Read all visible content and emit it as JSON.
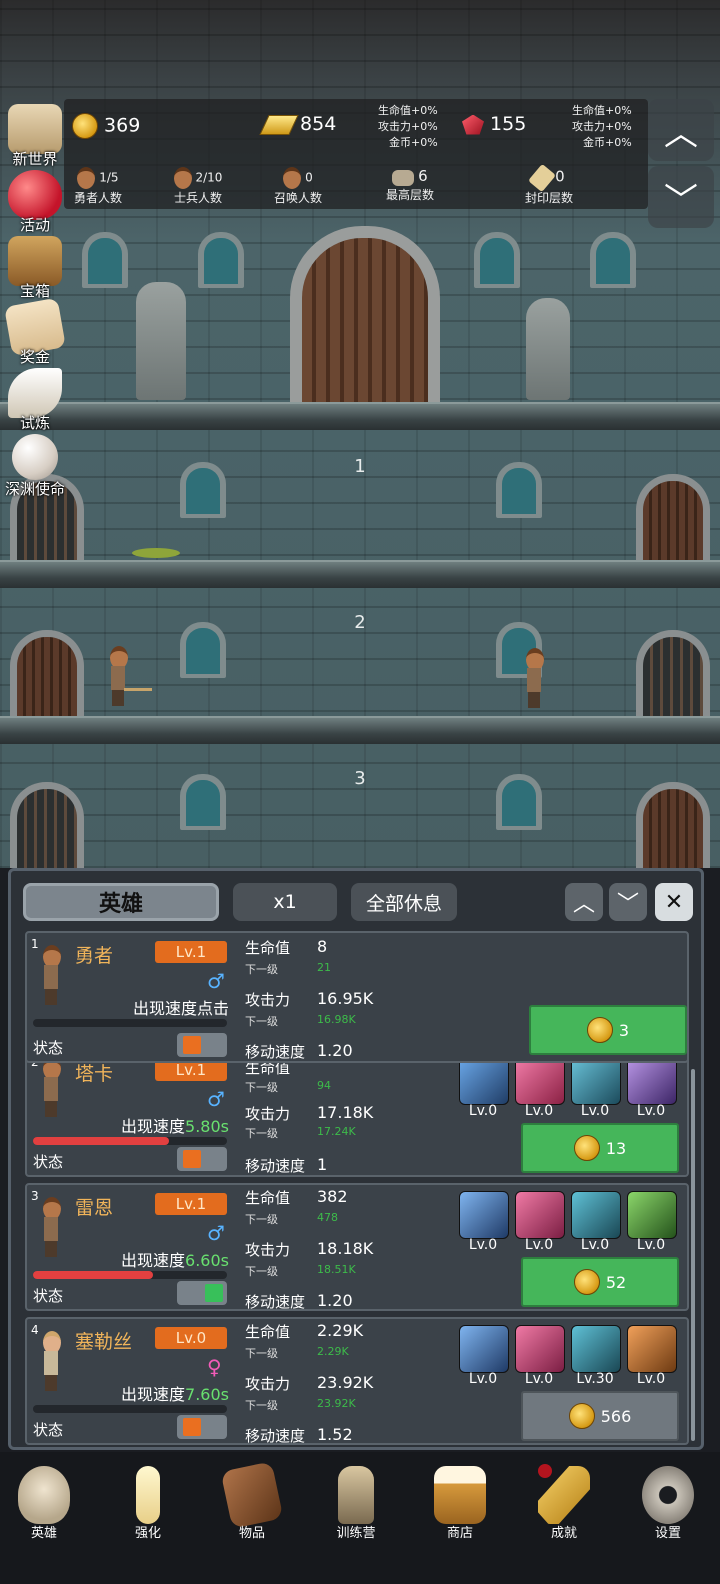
{
  "resources": {
    "coins": "369",
    "gold": "854",
    "gems": "155",
    "bonus_left": [
      "生命值+0%",
      "攻击力+0%",
      "金币+0%"
    ],
    "bonus_right": [
      "生命值+0%",
      "攻击力+0%",
      "金币+0%"
    ]
  },
  "counts": [
    {
      "value": "1/5",
      "label": "勇者人数"
    },
    {
      "value": "2/10",
      "label": "士兵人数"
    },
    {
      "value": "0",
      "label": "召唤人数"
    },
    {
      "value": "6",
      "label": "最高层数"
    },
    {
      "value": "0",
      "label": "封印层数"
    }
  ],
  "left_menu": [
    "新世界",
    "活动",
    "宝箱",
    "奖金",
    "试炼",
    "深渊使命"
  ],
  "floors": [
    "1",
    "2",
    "3"
  ],
  "panel": {
    "tab": "英雄",
    "speed": "x1",
    "rest_all": "全部休息"
  },
  "labels": {
    "hp": "生命值",
    "atk": "攻击力",
    "next": "下一级",
    "move": "移动速度",
    "state": "状态"
  },
  "heroes": [
    {
      "idx": "1",
      "name": "勇者",
      "lv": "Lv.1",
      "sex": "♂",
      "appear": "出现速度点击",
      "appear_time": "",
      "hp": "8",
      "hp_next": "21",
      "atk": "16.95K",
      "atk_next": "16.98K",
      "move": "1.20",
      "cost": "3",
      "bar": 0,
      "active": false,
      "equips": []
    },
    {
      "idx": "2",
      "name": "塔卡",
      "lv": "Lv.1",
      "sex": "♂",
      "appear": "出现速度",
      "appear_time": "5.80s",
      "hp": "",
      "hp_next": "94",
      "atk": "17.18K",
      "atk_next": "17.24K",
      "move": "1",
      "cost": "13",
      "bar": 0.7,
      "active": false,
      "equips": [
        "Lv.0",
        "Lv.0",
        "Lv.0",
        "Lv.0"
      ]
    },
    {
      "idx": "3",
      "name": "雷恩",
      "lv": "Lv.1",
      "sex": "♂",
      "appear": "出现速度",
      "appear_time": "6.60s",
      "hp": "382",
      "hp_next": "478",
      "atk": "18.18K",
      "atk_next": "18.51K",
      "move": "1.20",
      "cost": "52",
      "bar": 0.62,
      "active": true,
      "equips": [
        "Lv.0",
        "Lv.0",
        "Lv.0",
        "Lv.0"
      ]
    },
    {
      "idx": "4",
      "name": "塞勒丝",
      "lv": "Lv.0",
      "sex": "♀",
      "appear": "出现速度",
      "appear_time": "7.60s",
      "hp": "2.29K",
      "hp_next": "2.29K",
      "atk": "23.92K",
      "atk_next": "23.92K",
      "move": "1.52",
      "cost": "566",
      "bar": 0,
      "active": false,
      "equips": [
        "Lv.0",
        "Lv.0",
        "Lv.30",
        "Lv.0"
      ]
    }
  ],
  "nav": [
    "英雄",
    "强化",
    "物品",
    "训练营",
    "商店",
    "成就",
    "设置"
  ],
  "colors": {
    "accent_green": "#45b65a",
    "level_orange": "#e36c1e",
    "next_green": "#3dbb4a"
  }
}
